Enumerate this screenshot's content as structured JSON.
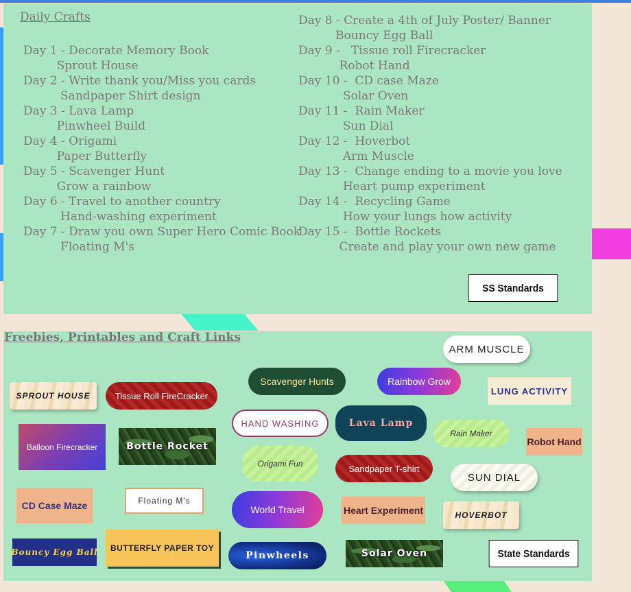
{
  "crafts": {
    "heading": "Daily Crafts ",
    "left": [
      {
        "day": "Day 1 - Decorate Memory Book",
        "second": "         Sprout House"
      },
      {
        "day": "Day 2 - Write thank you/Miss you cards",
        "second": "          Sandpaper Shirt design"
      },
      {
        "day": "Day 3 - Lava Lamp",
        "second": "         Pinwheel Build"
      },
      {
        "day": "Day 4 - Origami",
        "second": "         Paper Butterfly"
      },
      {
        "day": "Day 5 - Scavenger Hunt",
        "second": "         Grow a rainbow"
      },
      {
        "day": "Day 6 - Travel to another country",
        "second": "          Hand-washing experiment"
      },
      {
        "day": "Day 7 - Draw you own Super Hero Comic Book",
        "second": "          Floating M's"
      }
    ],
    "right": [
      {
        "day": "Day 8 - Create a 4th of July Poster/ Banner",
        "second": "          Bouncy Egg Ball"
      },
      {
        "day": "Day 9 -   Tissue roll Firecracker",
        "second": "           Robot Hand"
      },
      {
        "day": "Day 10 -  CD case Maze",
        "second": "            Solar Oven"
      },
      {
        "day": "Day 11 -  Rain Maker",
        "second": "            Sun Dial"
      },
      {
        "day": "Day 12 -  Hoverbot",
        "second": "            Arm Muscle"
      },
      {
        "day": "Day 13 -  Change ending to a movie you love",
        "second": "            Heart pump experiment"
      },
      {
        "day": "Day 14 -  Recycling Game",
        "second": "            How your lungs how activity"
      },
      {
        "day": "Day 15 -  Bottle Rockets",
        "second": "           Create and play your own new game"
      }
    ],
    "ss_button": "SS Standards"
  },
  "links": {
    "heading": "Freebies, Printables and Craft Links",
    "state_button": "State Standards",
    "items": {
      "arm_muscle": "ARM MUSCLE",
      "scavenger_hunts": "Scavenger Hunts",
      "rainbow_grow": "Rainbow Grow",
      "lung_activity": "LUNG ACTIVITY",
      "sprout_house": "SPROUT HOUSE",
      "tissue_roll": "Tissue Roll FireCracker",
      "hand_washing": "HAND WASHING",
      "lava_lamp": "Lava Lamp",
      "rain_maker": "Rain Maker",
      "robot_hand": "Robot Hand",
      "balloon_firecracker": "Balloon Firecracker",
      "bottle_rocket": "Bottle Rocket",
      "origami_fun": "Origami Fun",
      "sandpaper_tshirt": "Sandpaper T-shirt",
      "sun_dial": "SUN DIAL",
      "cd_case_maze": "CD Case Maze",
      "floating_ms": "Floating M's",
      "world_travel": "World Travel",
      "heart_experiment": "Heart Experiment",
      "hoverbot": "HOVERBOT",
      "bouncy_egg_ball": "Bouncy Egg Ball",
      "butterfly_paper_toy": "BUTTERFLY PAPER TOY",
      "pinwheels": "Pinwheels",
      "solar_oven": "Solar Oven"
    }
  },
  "colors": {
    "panel": "#abe6c2",
    "background": "#f3e6d8",
    "accent_magenta": "#f23ce0",
    "accent_teal": "#47f3c8"
  }
}
